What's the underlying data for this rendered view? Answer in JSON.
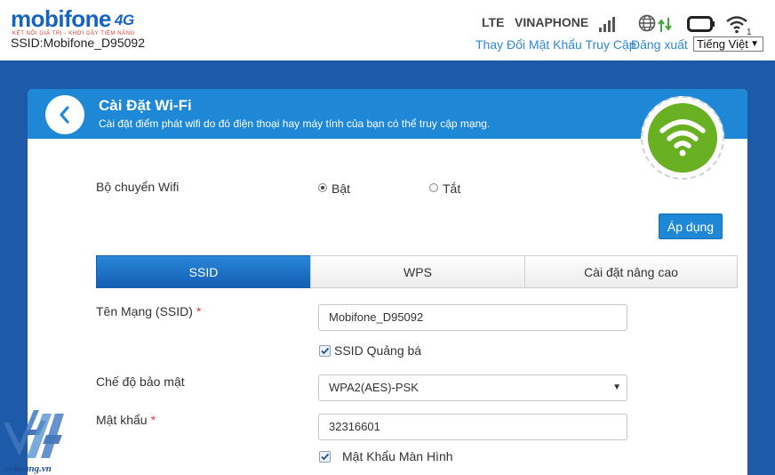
{
  "header": {
    "logo_text": "mobifone",
    "logo_4g": "4G",
    "logo_tagline": "KẾT NỐI GIÁ TRỊ - KHƠI DẬY TIỀM NĂNG",
    "ssid_text": "SSID:Mobifone_D95092",
    "network_type": "LTE",
    "operator": "VINAPHONE",
    "icons": [
      "signal-icon",
      "globe-icon",
      "data-transfer-icon",
      "battery-icon",
      "wifi-clients-icon"
    ],
    "wifi_clients": "1",
    "change_password_link": "Thay Đổi Mật Khẩu Truy Cập",
    "logout_link": "Đăng xuất",
    "language": "Tiếng Việt"
  },
  "page": {
    "title": "Cài Đặt Wi-Fi",
    "subtitle": "Cài đặt điểm phát wifi do đó điện thoại hay máy tính của bạn có thể truy cập mạng."
  },
  "wifi_switch": {
    "label": "Bộ chuyển Wifi",
    "on_label": "Bật",
    "off_label": "Tắt",
    "selected": "Bật"
  },
  "apply_label": "Áp dụng",
  "tabs": [
    {
      "label": "SSID",
      "active": true
    },
    {
      "label": "WPS",
      "active": false
    },
    {
      "label": "Cài đặt nâng cao",
      "active": false
    }
  ],
  "ssid_form": {
    "name_label": "Tên Mạng (SSID)",
    "required_mark": "*",
    "name_value": "Mobifone_D95092",
    "broadcast_label": "SSID Quảng bá",
    "broadcast_checked": true,
    "security_label": "Chế độ bảo mật",
    "security_value": "WPA2(AES)-PSK",
    "password_label": "Mật khẩu",
    "password_value": "32316601",
    "show_password_label": "Mật Khẩu Màn Hình",
    "show_password_checked": true
  },
  "watermark": {
    "text": "vohoang.vn"
  },
  "colors": {
    "brand_blue": "#1e88d7",
    "band_blue": "#1d5aa8",
    "wifi_green": "#6ab023",
    "link_blue": "#2d8ad6",
    "required_red": "#e53935"
  }
}
